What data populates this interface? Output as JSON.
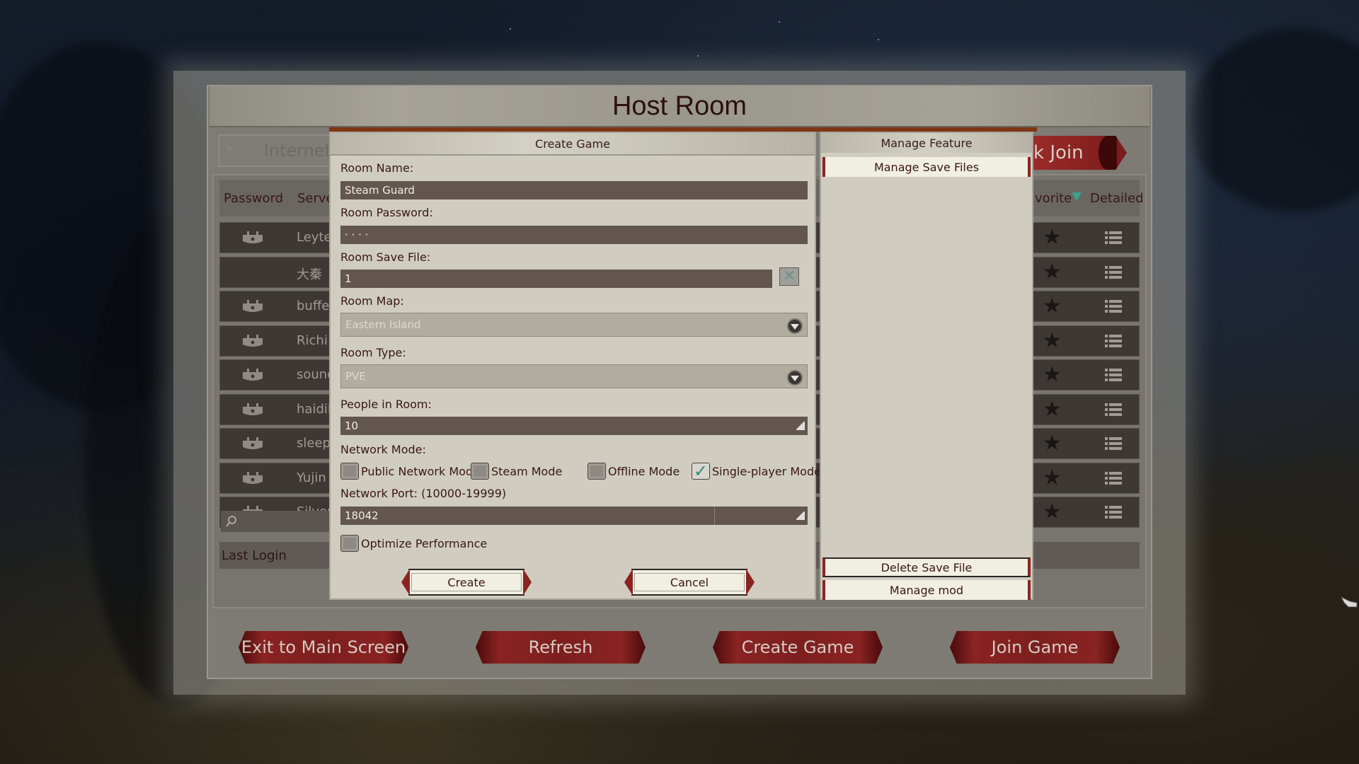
{
  "window": {
    "title": "Host Room"
  },
  "top_tabs": {
    "internet": "Internet",
    "quick_join": "k Join"
  },
  "server_list": {
    "columns": {
      "password": "Password",
      "server": "Serve",
      "favorite": "vorite",
      "detailed": "Detailed"
    },
    "sort_indicator_color": "#3fa08f",
    "rows": [
      {
        "name": "Leyte",
        "locked": true
      },
      {
        "name": "大秦",
        "locked": false
      },
      {
        "name": "buffet",
        "locked": true
      },
      {
        "name": "Richi",
        "locked": true
      },
      {
        "name": "sound",
        "locked": true
      },
      {
        "name": "haidil",
        "locked": true
      },
      {
        "name": "sleepy",
        "locked": true
      },
      {
        "name": "Yujin",
        "locked": true
      },
      {
        "name": "Silver",
        "locked": true
      }
    ],
    "last_login_label": "Last Login"
  },
  "create_game": {
    "header": "Create Game",
    "room_name_label": "Room Name:",
    "room_name_value": "Steam Guard",
    "room_password_label": "Room Password:",
    "room_password_value": "· · · ·",
    "room_save_file_label": "Room Save File:",
    "room_save_file_value": "1",
    "room_map_label": "Room Map:",
    "room_map_value": "Eastern Island",
    "room_type_label": "Room Type:",
    "room_type_value": "PVE",
    "people_label": "People in Room:",
    "people_value": "10",
    "network_mode_label": "Network Mode:",
    "network_modes": [
      {
        "label": "Public Network Mode",
        "checked": false
      },
      {
        "label": "Steam Mode",
        "checked": false
      },
      {
        "label": "Offline Mode",
        "checked": false
      },
      {
        "label": "Single-player Mode",
        "checked": true
      }
    ],
    "port_label": "Network Port: (10000-19999)",
    "port_value": "18042",
    "optimize_label": "Optimize Performance",
    "optimize_checked": false,
    "create_button": "Create",
    "cancel_button": "Cancel"
  },
  "manage_feature": {
    "header": "Manage Feature",
    "manage_save_files": "Manage Save Files",
    "delete_save_file": "Delete Save File",
    "manage_mod": "Manage mod"
  },
  "bottom_buttons": {
    "exit": "Exit to Main Screen",
    "refresh": "Refresh",
    "create_game": "Create Game",
    "join_game": "Join Game"
  },
  "colors": {
    "accent_red": "#8a2421",
    "check_teal": "#2f8c7e",
    "title_text": "#2b1010"
  }
}
